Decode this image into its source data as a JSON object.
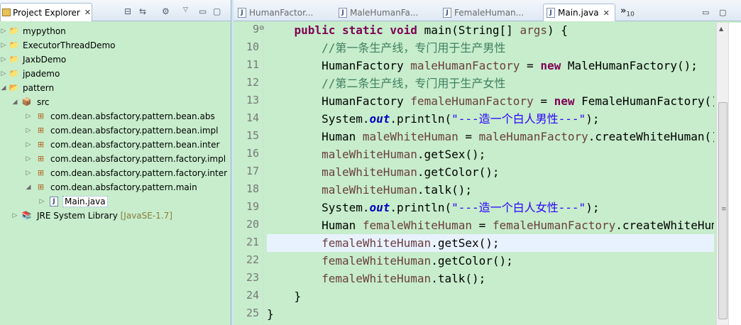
{
  "explorer": {
    "tab_label": "Project Explorer",
    "close_glyph": "✕",
    "toolbar_icons": [
      "collapse-all-icon",
      "link-with-editor-icon",
      "filter-icon",
      "view-menu-icon",
      "minimize-icon",
      "maximize-icon"
    ],
    "tree": [
      {
        "label": "mypython",
        "icon": "project-icon",
        "expanded": false
      },
      {
        "label": "ExecutorThreadDemo",
        "icon": "project-icon",
        "expanded": false
      },
      {
        "label": "JaxbDemo",
        "icon": "project-icon",
        "expanded": false
      },
      {
        "label": "jpademo",
        "icon": "project-icon",
        "expanded": false
      },
      {
        "label": "pattern",
        "icon": "project-icon",
        "expanded": true
      },
      {
        "label": "src",
        "icon": "source-folder-icon",
        "expanded": true
      },
      {
        "label": "com.dean.absfactory.pattern.bean.abs",
        "icon": "package-icon",
        "expanded": false
      },
      {
        "label": "com.dean.absfactory.pattern.bean.impl",
        "icon": "package-icon",
        "expanded": false
      },
      {
        "label": "com.dean.absfactory.pattern.bean.inter",
        "icon": "package-icon",
        "expanded": false
      },
      {
        "label": "com.dean.absfactory.pattern.factory.impl",
        "icon": "package-icon",
        "expanded": false
      },
      {
        "label": "com.dean.absfactory.pattern.factory.inter",
        "icon": "package-icon",
        "expanded": false
      },
      {
        "label": "com.dean.absfactory.pattern.main",
        "icon": "package-icon",
        "expanded": true
      },
      {
        "label": "Main.java",
        "icon": "java-file-icon",
        "expanded": false,
        "selected": true
      },
      {
        "label": "JRE System Library",
        "decoration": "[JavaSE-1.7]",
        "icon": "library-icon",
        "expanded": false
      }
    ]
  },
  "editor": {
    "tabs": [
      {
        "label": "HumanFactor...",
        "active": false
      },
      {
        "label": "MaleHumanFa...",
        "active": false
      },
      {
        "label": "FemaleHuman...",
        "active": false
      },
      {
        "label": "Main.java",
        "active": true
      }
    ],
    "overflow_label": "»",
    "overflow_count": "10",
    "current_line": "21",
    "lines": [
      {
        "n": "9",
        "fold": "⊖",
        "code": "    public static void main(String[] args) {"
      },
      {
        "n": "10",
        "code": "        //第一条生产线，专门用于生产男性"
      },
      {
        "n": "11",
        "code": "        HumanFactory maleHumanFactory = new MaleHumanFactory();"
      },
      {
        "n": "12",
        "code": "        //第二条生产线，专门用于生产女性"
      },
      {
        "n": "13",
        "code": "        HumanFactory femaleHumanFactory = new FemaleHumanFactory();"
      },
      {
        "n": "14",
        "code": "        System.out.println(\"---造一个白人男性---\");"
      },
      {
        "n": "15",
        "code": "        Human maleWhiteHuman = maleHumanFactory.createWhiteHuman();"
      },
      {
        "n": "16",
        "code": "        maleWhiteHuman.getSex();"
      },
      {
        "n": "17",
        "code": "        maleWhiteHuman.getColor();"
      },
      {
        "n": "18",
        "code": "        maleWhiteHuman.talk();"
      },
      {
        "n": "19",
        "code": "        System.out.println(\"---造一个白人女性---\");"
      },
      {
        "n": "20",
        "code": "        Human femaleWhiteHuman = femaleHumanFactory.createWhiteHuman();"
      },
      {
        "n": "21",
        "code": "        femaleWhiteHuman.getSex();"
      },
      {
        "n": "22",
        "code": "        femaleWhiteHuman.getColor();"
      },
      {
        "n": "23",
        "code": "        femaleWhiteHuman.talk();"
      },
      {
        "n": "24",
        "code": "    }"
      },
      {
        "n": "25",
        "code": "}"
      }
    ]
  },
  "colors": {
    "editor_background": "#c7edcc",
    "current_line_highlight": "#e8f2fe",
    "keyword": "#7f0055",
    "comment": "#3f7f5f",
    "string": "#2a00ff",
    "static_field": "#0000c0"
  }
}
